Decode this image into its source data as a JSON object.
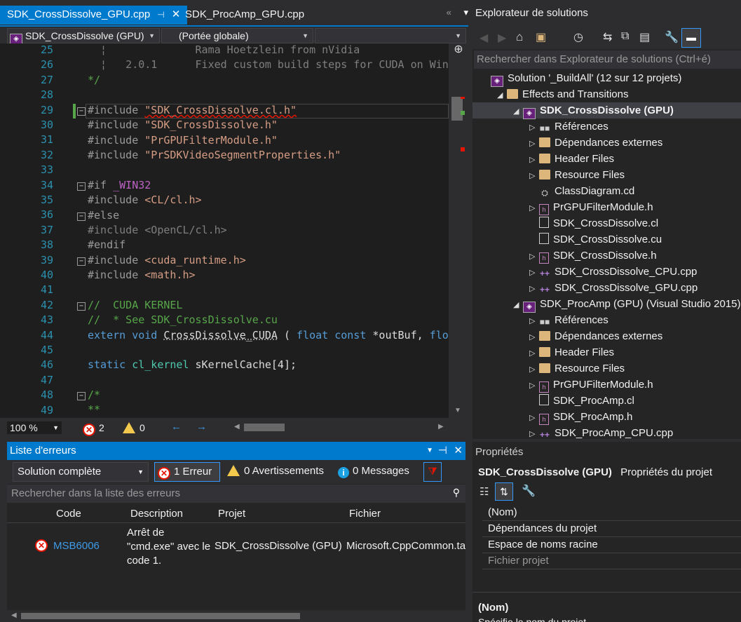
{
  "editor": {
    "tabs": [
      {
        "label": "SDK_CrossDissolve_GPU.cpp",
        "active": true
      },
      {
        "label": "SDK_ProcAmp_GPU.cpp",
        "active": false
      }
    ],
    "project_combo": "SDK_CrossDissolve (GPU)",
    "scope_combo": "(Portée globale)",
    "line_numbers": [
      "25",
      "26",
      "27",
      "28",
      "29",
      "30",
      "31",
      "32",
      "33",
      "34",
      "35",
      "36",
      "37",
      "38",
      "39",
      "40",
      "41",
      "42",
      "43",
      "44",
      "45",
      "46",
      "47",
      "48",
      "49"
    ],
    "zoom": "100 %",
    "error_count": "2",
    "warning_count": "0"
  },
  "solution_explorer": {
    "title": "Explorateur de solutions",
    "search_placeholder": "Rechercher dans Explorateur de solutions (Ctrl+é)",
    "items": [
      {
        "label": "Solution '_BuildAll' (12 sur 12 projets)",
        "icon": "solution-icon"
      },
      {
        "label": "Effects and Transitions",
        "icon": "folder-icon"
      },
      {
        "label": "SDK_CrossDissolve (GPU)",
        "icon": "project-icon",
        "bold": true
      },
      {
        "label": "Références",
        "icon": "references-icon"
      },
      {
        "label": "Dépendances externes",
        "icon": "folder-icon"
      },
      {
        "label": "Header Files",
        "icon": "folder-icon"
      },
      {
        "label": "Resource Files",
        "icon": "folder-icon"
      },
      {
        "label": "ClassDiagram.cd",
        "icon": "class-diagram-icon"
      },
      {
        "label": "PrGPUFilterModule.h",
        "icon": "header-file-icon"
      },
      {
        "label": "SDK_CrossDissolve.cl",
        "icon": "file-icon"
      },
      {
        "label": "SDK_CrossDissolve.cu",
        "icon": "file-icon"
      },
      {
        "label": "SDK_CrossDissolve.h",
        "icon": "header-file-icon"
      },
      {
        "label": "SDK_CrossDissolve_CPU.cpp",
        "icon": "cpp-file-icon"
      },
      {
        "label": "SDK_CrossDissolve_GPU.cpp",
        "icon": "cpp-file-icon"
      },
      {
        "label": "SDK_ProcAmp (GPU) (Visual Studio 2015)",
        "icon": "project-icon"
      },
      {
        "label": "Références",
        "icon": "references-icon"
      },
      {
        "label": "Dépendances externes",
        "icon": "folder-icon"
      },
      {
        "label": "Header Files",
        "icon": "folder-icon"
      },
      {
        "label": "Resource Files",
        "icon": "folder-icon"
      },
      {
        "label": "PrGPUFilterModule.h",
        "icon": "header-file-icon"
      },
      {
        "label": "SDK_ProcAmp.cl",
        "icon": "file-icon"
      },
      {
        "label": "SDK_ProcAmp.h",
        "icon": "header-file-icon"
      },
      {
        "label": "SDK_ProcAmp_CPU.cpp",
        "icon": "cpp-file-icon"
      }
    ]
  },
  "error_list": {
    "title": "Liste d'erreurs",
    "scope": "Solution complète",
    "errors_label": "1 Erreur",
    "warnings_label": "0 Avertissements",
    "messages_label": "0 Messages",
    "search_placeholder": "Rechercher dans la liste des erreurs",
    "columns": [
      "Code",
      "Description",
      "Projet",
      "Fichier"
    ],
    "rows": [
      {
        "code": "MSB6006",
        "description": "Arrêt de \"cmd.exe\" avec le code 1.",
        "project": "SDK_CrossDissolve (GPU)",
        "file": "Microsoft.CppCommon.targets"
      }
    ]
  },
  "properties": {
    "title": "Propriétés",
    "object": "SDK_CrossDissolve (GPU)",
    "object_type": "Propriétés du projet",
    "rows": [
      "(Nom)",
      "Dépendances du projet",
      "Espace de noms racine",
      "Fichier projet"
    ],
    "desc_title": "(Nom)",
    "desc_text": "Spécifie le nom du projet."
  },
  "colors": {
    "accent": "#007acc",
    "error": "#e51400",
    "warning": "#f2c94c"
  }
}
